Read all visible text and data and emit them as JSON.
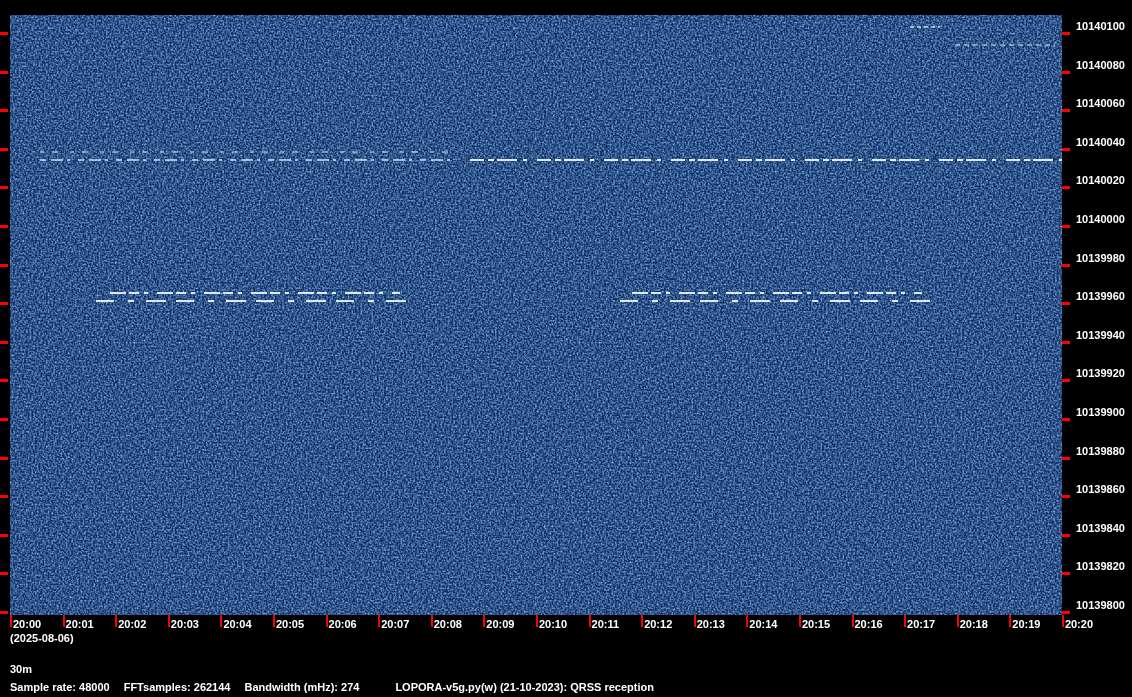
{
  "frequency_axis": {
    "labels": [
      "10140100",
      "10140080",
      "10140060",
      "10140040",
      "10140020",
      "10140000",
      "10139980",
      "10139960",
      "10139940",
      "10139920",
      "10139900",
      "10139880",
      "10139860",
      "10139840",
      "10139820",
      "10139800"
    ]
  },
  "time_axis": {
    "labels": [
      "20:00",
      "20:01",
      "20:02",
      "20:03",
      "20:04",
      "20:05",
      "20:06",
      "20:07",
      "20:08",
      "20:09",
      "20:10",
      "20:11",
      "20:12",
      "20:13",
      "20:14",
      "20:15",
      "20:16",
      "20:17",
      "20:18",
      "20:19",
      "20:20"
    ],
    "date": "(2025-08-06)"
  },
  "band": "30m",
  "status_bar": {
    "items": [
      "Sample rate: 48000",
      "FFTsamples: 262144",
      "Bandwidth (mHz): 274",
      "LOPORA-v5g.py(w) (21-10-2023): QRSS reception"
    ]
  }
}
